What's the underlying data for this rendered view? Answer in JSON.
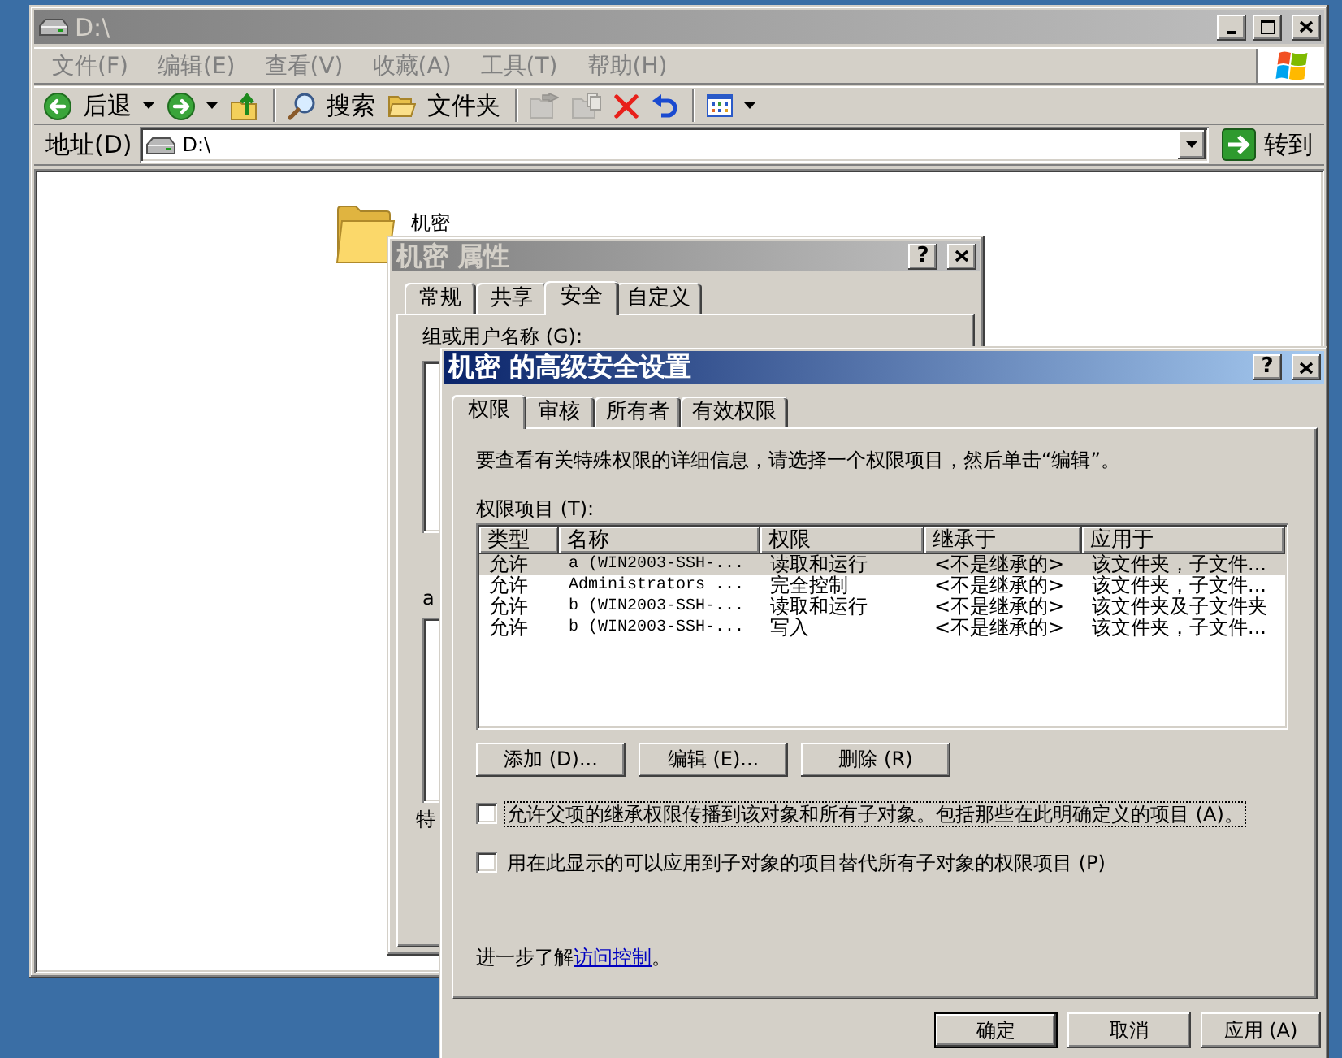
{
  "explorer": {
    "title": "D:\\",
    "active": false,
    "menu": [
      "文件(F)",
      "编辑(E)",
      "查看(V)",
      "收藏(A)",
      "工具(T)",
      "帮助(H)"
    ],
    "toolbar": [
      {
        "kind": "back",
        "label": "后退",
        "dropdown": true,
        "disabled": false
      },
      {
        "kind": "forward",
        "dropdown": true,
        "disabled": false
      },
      {
        "kind": "up",
        "dropdown": false,
        "disabled": false
      },
      {
        "kind": "separator"
      },
      {
        "kind": "search",
        "label": "搜索",
        "dropdown": false,
        "disabled": false
      },
      {
        "kind": "folders",
        "label": "文件夹",
        "dropdown": false,
        "disabled": false
      },
      {
        "kind": "separator"
      },
      {
        "kind": "move",
        "dropdown": false,
        "disabled": true
      },
      {
        "kind": "copy",
        "dropdown": false,
        "disabled": true
      },
      {
        "kind": "delete",
        "dropdown": false,
        "disabled": false
      },
      {
        "kind": "undo",
        "dropdown": false,
        "disabled": false
      },
      {
        "kind": "separator"
      },
      {
        "kind": "views",
        "dropdown": true,
        "disabled": false
      }
    ],
    "address": {
      "label": "地址(D)",
      "value": "D:\\",
      "go": "转到"
    },
    "items": [
      {
        "name": "机密",
        "selected": false
      }
    ]
  },
  "properties_dialog": {
    "title": "机密 属性",
    "active": false,
    "help": "?",
    "tabs": [
      {
        "label": "常规",
        "selected": false
      },
      {
        "label": "共享",
        "selected": false
      },
      {
        "label": "安全",
        "selected": true
      },
      {
        "label": "自定义",
        "selected": false
      }
    ],
    "group_label": "组或用户名称 (G):",
    "permissions_label": "a",
    "special_label": "特"
  },
  "advanced_security_dialog": {
    "title": "机密 的高级安全设置",
    "active": true,
    "help": "?",
    "tabs": [
      {
        "label": "权限",
        "selected": true
      },
      {
        "label": "审核",
        "selected": false
      },
      {
        "label": "所有者",
        "selected": false
      },
      {
        "label": "有效权限",
        "selected": false
      }
    ],
    "intro": "要查看有关特殊权限的详细信息，请选择一个权限项目，然后单击“编辑”。",
    "list_label": "权限项目 (T):",
    "columns": [
      "类型",
      "名称",
      "权限",
      "继承于",
      "应用于"
    ],
    "rows": [
      {
        "selected": true,
        "cells": [
          "允许",
          "a (WIN2003-SSH-...",
          "读取和运行",
          "<不是继承的>",
          "该文件夹，子文件..."
        ]
      },
      {
        "selected": false,
        "cells": [
          "允许",
          "Administrators ...",
          "完全控制",
          "<不是继承的>",
          "该文件夹，子文件..."
        ]
      },
      {
        "selected": false,
        "cells": [
          "允许",
          "b (WIN2003-SSH-...",
          "读取和运行",
          "<不是继承的>",
          "该文件夹及子文件夹"
        ]
      },
      {
        "selected": false,
        "cells": [
          "允许",
          "b (WIN2003-SSH-...",
          "写入",
          "<不是继承的>",
          "该文件夹，子文件..."
        ]
      }
    ],
    "buttons": [
      "添加 (D)...",
      "编辑 (E)...",
      "删除 (R)"
    ],
    "checkboxes": [
      {
        "label": "允许父项的继承权限传播到该对象和所有子对象。包括那些在此明确定义的项目 (A)。",
        "checked": false,
        "focused": true
      },
      {
        "label": "用在此显示的可以应用到子对象的项目替代所有子对象的权限项目 (P)",
        "checked": false,
        "focused": false
      }
    ],
    "learn_more": {
      "text": "进一步了解",
      "link": "访问控制",
      "suffix": "。"
    },
    "footer_buttons": [
      {
        "label": "确定",
        "default": true
      },
      {
        "label": "取消",
        "default": false
      },
      {
        "label": "应用 (A)",
        "default": false
      }
    ]
  }
}
